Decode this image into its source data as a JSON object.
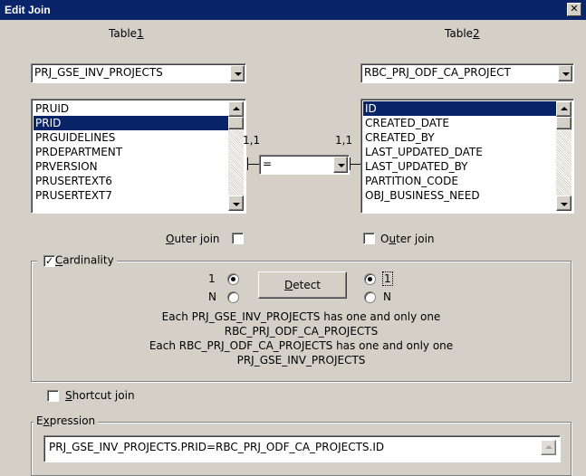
{
  "window": {
    "title": "Edit Join",
    "close_glyph": "✕"
  },
  "table1": {
    "label_pre": "Table",
    "label_accel": "1",
    "selected": "PRJ_GSE_INV_PROJECTS",
    "columns": [
      "PRUID",
      "PRID",
      "PRGUIDELINES",
      "PRDEPARTMENT",
      "PRVERSION",
      "PRUSERTEXT6",
      "PRUSERTEXT7"
    ],
    "selected_column": "PRID",
    "outer_join": {
      "label_pre": "",
      "label_accel": "O",
      "label_post": "uter join",
      "checked": false
    }
  },
  "table2": {
    "label_pre": "Table",
    "label_accel": "2",
    "selected": "RBC_PRJ_ODF_CA_PROJECT",
    "columns": [
      "ID",
      "CREATED_DATE",
      "CREATED_BY",
      "LAST_UPDATED_DATE",
      "LAST_UPDATED_BY",
      "PARTITION_CODE",
      "OBJ_BUSINESS_NEED"
    ],
    "selected_column": "ID",
    "outer_join": {
      "label_pre": "O",
      "label_accel": "u",
      "label_post": "ter join",
      "checked": false
    }
  },
  "operator": {
    "value": "=",
    "left_cardinality": "1,1",
    "right_cardinality": "1,1"
  },
  "cardinality": {
    "label_pre": "",
    "label_accel": "C",
    "label_post": "ardinality",
    "checked": true,
    "left_options": [
      "1",
      "N"
    ],
    "left_selected": "1",
    "right_options": [
      "1",
      "N"
    ],
    "right_selected": "1",
    "detect_button": {
      "label_accel": "D",
      "label_post": "etect"
    },
    "description_lines": [
      "Each PRJ_GSE_INV_PROJECTS has one and only one",
      "RBC_PRJ_ODF_CA_PROJECTS",
      "Each RBC_PRJ_ODF_CA_PROJECTS has one and only one",
      "PRJ_GSE_INV_PROJECTS"
    ]
  },
  "shortcut_join": {
    "label_pre": "",
    "label_accel": "S",
    "label_post": "hortcut join",
    "checked": false
  },
  "expression": {
    "label_pre": "E",
    "label_accel": "x",
    "label_post": "pression",
    "value": "PRJ_GSE_INV_PROJECTS.PRID=RBC_PRJ_ODF_CA_PROJECTS.ID"
  },
  "colors": {
    "title_bar": "#0a246a",
    "dialog_bg": "#d4d0c8",
    "selection": "#0a246a"
  }
}
